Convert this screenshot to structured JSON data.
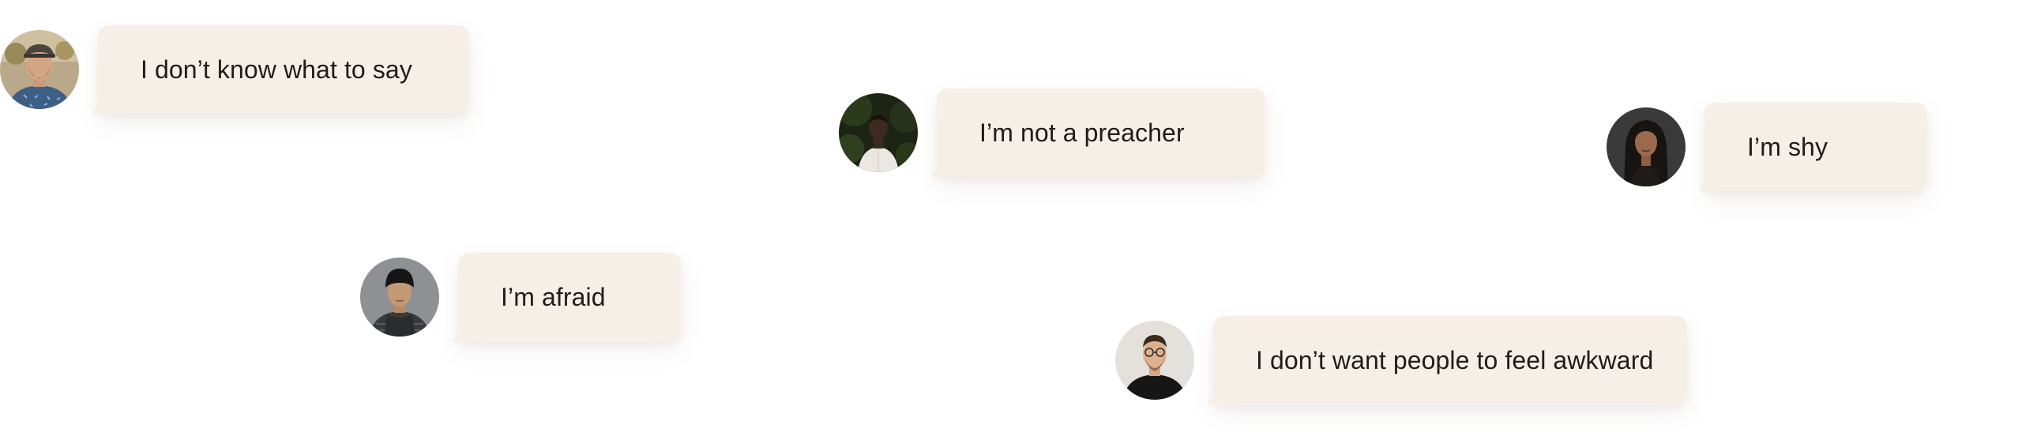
{
  "messages": [
    {
      "text": "I don’t know what to say",
      "avatar": "man-with-cap-avatar"
    },
    {
      "text": "I’m not a preacher",
      "avatar": "man-dark-background-avatar"
    },
    {
      "text": "I’m shy",
      "avatar": "woman-long-hair-avatar"
    },
    {
      "text": "I’m afraid",
      "avatar": "man-with-beanie-avatar"
    },
    {
      "text": "I don’t want people to feel awkward",
      "avatar": "man-with-glasses-avatar"
    }
  ],
  "colors": {
    "bubble_background": "#f6efe8",
    "text": "#1f1c1a",
    "page_background": "#ffffff"
  }
}
